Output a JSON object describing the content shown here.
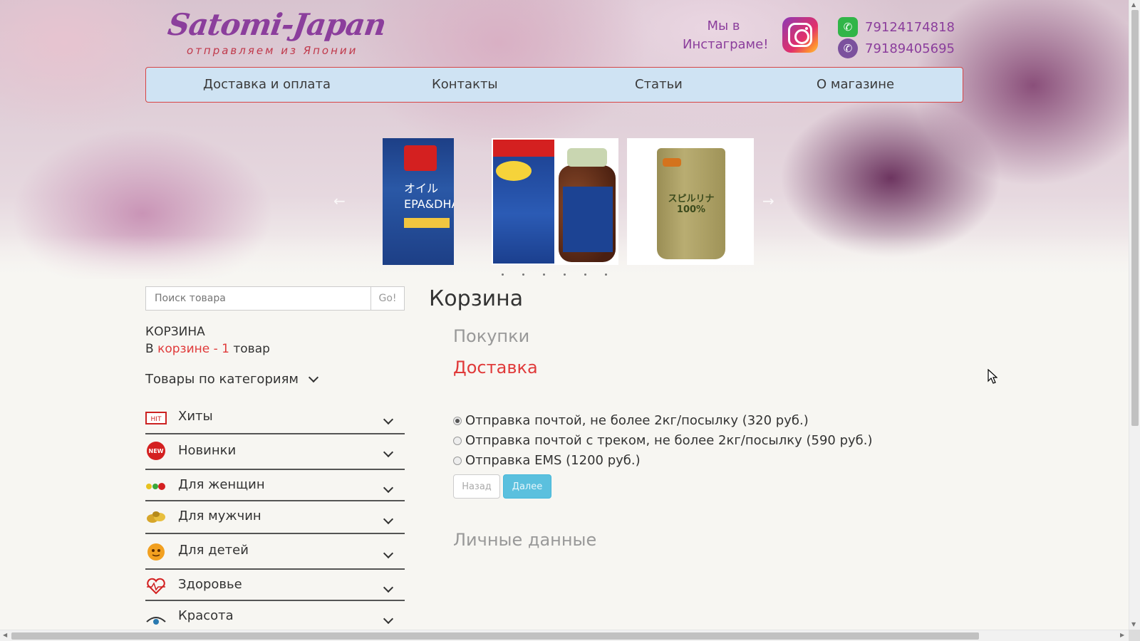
{
  "header": {
    "logo_title": "Satomi-Japan",
    "logo_subtitle": "отправляем из Японии",
    "instagram_text": "Мы в Инстаграме!",
    "phones": [
      "79124174818",
      "79189405695"
    ]
  },
  "nav": {
    "items": [
      "Доставка и оплата",
      "Контакты",
      "Статьи",
      "О магазине"
    ]
  },
  "carousel": {
    "prev_arrow": "←",
    "next_arrow": "→",
    "products": [
      "omega-3",
      "squalene",
      "spirulina"
    ],
    "dots": 6
  },
  "sidebar": {
    "search_placeholder": "Поиск товара",
    "search_button": "Go!",
    "cart_title": "КОРЗИНА",
    "cart_prefix": "В ",
    "cart_link": "корзине - 1",
    "cart_suffix": " товар",
    "categories_header": "Товары по категориям",
    "categories": [
      {
        "label": "Хиты",
        "icon": "hit-icon"
      },
      {
        "label": "Новинки",
        "icon": "new-icon"
      },
      {
        "label": "Для женщин",
        "icon": "women-icon"
      },
      {
        "label": "Для мужчин",
        "icon": "men-icon"
      },
      {
        "label": "Для детей",
        "icon": "kids-icon"
      },
      {
        "label": "Здоровье",
        "icon": "health-icon"
      },
      {
        "label": "Красота",
        "icon": "beauty-icon"
      }
    ]
  },
  "main": {
    "title": "Корзина",
    "step_purchases": "Покупки",
    "step_delivery": "Доставка",
    "step_personal": "Личные данные",
    "delivery_options": [
      {
        "label": "Отправка почтой, не более 2кг/посылку (320 руб.)",
        "selected": true
      },
      {
        "label": "Отправка почтой с треком, не более 2кг/посылку (590 руб.)",
        "selected": false
      },
      {
        "label": "Отправка EMS (1200 руб.)",
        "selected": false
      }
    ],
    "back_button": "Назад",
    "next_button": "Далее"
  },
  "colors": {
    "brand_purple": "#8b3e9c",
    "accent_red": "#e03a3a",
    "nav_bg": "#cfe3f3",
    "primary_button": "#5bc0de"
  }
}
